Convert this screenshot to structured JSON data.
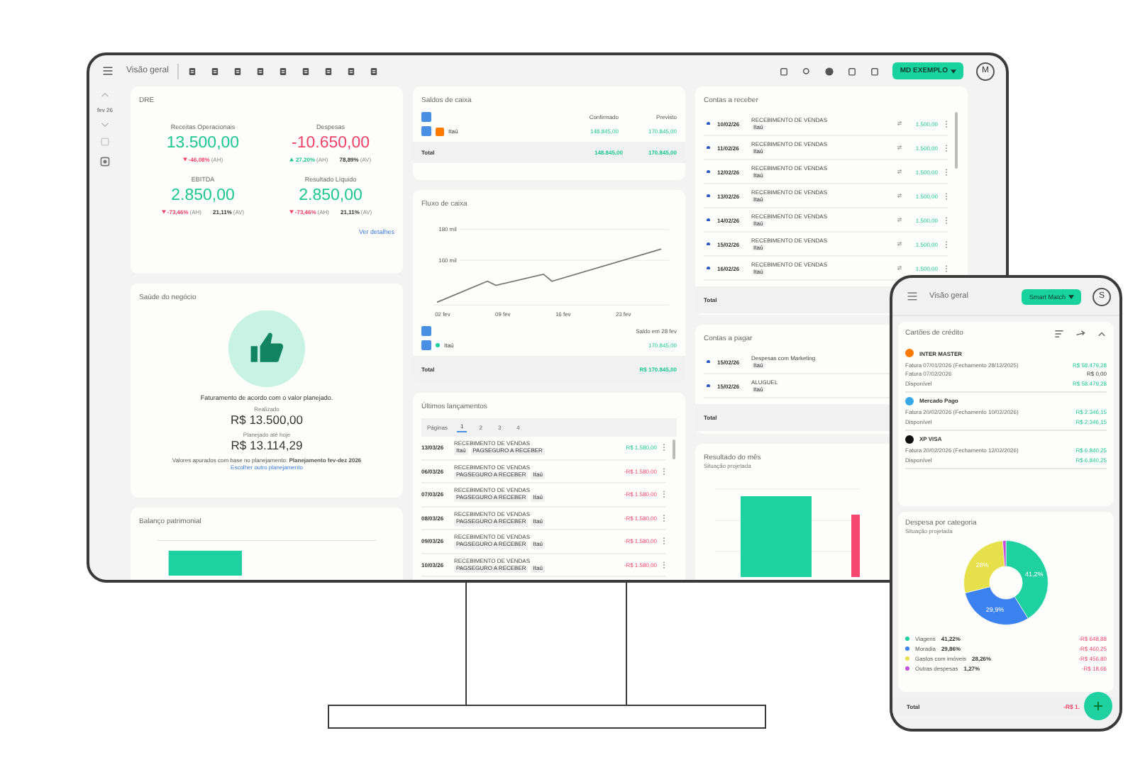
{
  "monitor": {
    "topbar": {
      "title": "Visão geral",
      "account_button": "MD EXEMPLO",
      "avatar": "M"
    },
    "rail": {
      "period": "fev 26"
    },
    "dre": {
      "title": "DRE",
      "metrics": [
        {
          "label": "Receitas Operacionais",
          "value": "13.500,00",
          "negative": false,
          "changes": [
            {
              "kind": "down",
              "text": "-46,08%",
              "tag": "(AH)"
            }
          ]
        },
        {
          "label": "Despesas",
          "value": "-10.650,00",
          "negative": true,
          "changes": [
            {
              "kind": "up",
              "text": "27,20%",
              "tag": "(AH)"
            },
            {
              "kind": "plain",
              "text": "78,89%",
              "tag": "(AV)"
            }
          ]
        },
        {
          "label": "EBITDA",
          "value": "2.850,00",
          "negative": false,
          "changes": [
            {
              "kind": "down",
              "text": "-73,46%",
              "tag": "(AH)"
            },
            {
              "kind": "plain",
              "text": "21,11%",
              "tag": "(AV)"
            }
          ]
        },
        {
          "label": "Resultado Líquido",
          "value": "2.850,00",
          "negative": false,
          "changes": [
            {
              "kind": "down",
              "text": "-73,46%",
              "tag": "(AH)"
            },
            {
              "kind": "plain",
              "text": "21,11%",
              "tag": "(AV)"
            }
          ]
        }
      ],
      "link": "Ver detalhes"
    },
    "health": {
      "title": "Saúde do negócio",
      "message": "Faturamento de acordo com o valor planejado.",
      "realized_label": "Realizado",
      "realized": "R$ 13.500,00",
      "planned_label": "Planejado até hoje",
      "planned": "R$ 13.114,29",
      "note": "Valores apurados com base no planejamento: **Planejamento fev-dez 2026**",
      "link": "Escolher outro planejamento"
    },
    "balance": {
      "title": "Balanço patrimonial"
    },
    "cash": {
      "title": "Saldos de caixa",
      "all_checked": true,
      "columns": [
        "Confirmado",
        "Previsto"
      ],
      "rows": [
        {
          "checked": true,
          "bank": "Itaú",
          "confirmed": "148.845,00",
          "projected": "170.845,00"
        }
      ],
      "total_label": "Total",
      "total_confirmed": "148.845,00",
      "total_projected": "170.845,00"
    },
    "flow": {
      "title": "Fluxo de caixa",
      "y_labels": [
        "180 mil",
        "160 mil"
      ],
      "x_labels": [
        "02 fev",
        "09 fev",
        "16 fev",
        "23 fev"
      ],
      "legend_all_checked": true,
      "legend_title": "Saldo em 28 fev",
      "legend": [
        {
          "checked": true,
          "name": "Itaú",
          "value": "170.845,00"
        }
      ],
      "total_label": "Total",
      "total": "R$ 170.845,00"
    },
    "entries": {
      "title": "Últimos lançamentos",
      "pages_label": "Páginas",
      "pages": [
        {
          "label": "1",
          "selected": true
        },
        {
          "label": "2",
          "selected": false
        },
        {
          "label": "3",
          "selected": false
        },
        {
          "label": "4",
          "selected": false
        }
      ],
      "rows": [
        {
          "date": "13/03/26",
          "description": "RECEBIMENTO DE VENDAS",
          "tags": [
            "Itaú",
            "PAGSEGURO A RECEBER"
          ],
          "amount": "R$ 1.580,00",
          "negative": false
        },
        {
          "date": "06/03/26",
          "description": "RECEBIMENTO DE VENDAS",
          "tags": [
            "PAGSEGURO A RECEBER",
            "Itaú"
          ],
          "amount": "-R$ 1.580,00",
          "negative": true
        },
        {
          "date": "07/03/26",
          "description": "RECEBIMENTO DE VENDAS",
          "tags": [
            "PAGSEGURO A RECEBER",
            "Itaú"
          ],
          "amount": "-R$ 1.580,00",
          "negative": true
        },
        {
          "date": "08/03/26",
          "description": "RECEBIMENTO DE VENDAS",
          "tags": [
            "PAGSEGURO A RECEBER",
            "Itaú"
          ],
          "amount": "-R$ 1.580,00",
          "negative": true
        },
        {
          "date": "09/03/26",
          "description": "RECEBIMENTO DE VENDAS",
          "tags": [
            "PAGSEGURO A RECEBER",
            "Itaú"
          ],
          "amount": "-R$ 1.580,00",
          "negative": true
        },
        {
          "date": "10/03/26",
          "description": "RECEBIMENTO DE VENDAS",
          "tags": [
            "PAGSEGURO A RECEBER",
            "Itaú"
          ],
          "amount": "-R$ 1.580,00",
          "negative": true
        }
      ]
    },
    "receivables": {
      "title": "Contas a receber",
      "rows": [
        {
          "date": "10/02/26",
          "description": "RECEBIMENTO DE VENDAS",
          "tag": "Itaú",
          "amount": "1.500,00"
        },
        {
          "date": "11/02/26",
          "description": "RECEBIMENTO DE VENDAS",
          "tag": "Itaú",
          "amount": "1.500,00"
        },
        {
          "date": "12/02/26",
          "description": "RECEBIMENTO DE VENDAS",
          "tag": "Itaú",
          "amount": "1.500,00"
        },
        {
          "date": "13/02/26",
          "description": "RECEBIMENTO DE VENDAS",
          "tag": "Itaú",
          "amount": "1.500,00"
        },
        {
          "date": "14/02/26",
          "description": "RECEBIMENTO DE VENDAS",
          "tag": "Itaú",
          "amount": "1.500,00"
        },
        {
          "date": "15/02/26",
          "description": "RECEBIMENTO DE VENDAS",
          "tag": "Itaú",
          "amount": "1.500,00"
        },
        {
          "date": "16/02/26",
          "description": "RECEBIMENTO DE VENDAS",
          "tag": "Itaú",
          "amount": "1.500,00"
        }
      ],
      "total_label": "Total"
    },
    "payables": {
      "title": "Contas a pagar",
      "rows": [
        {
          "date": "15/02/26",
          "description": "Despesas com Marketing",
          "tag": "Itaú"
        },
        {
          "date": "15/02/26",
          "description": "ALUGUEL",
          "tag": "Itaú"
        }
      ],
      "total_label": "Total"
    },
    "result": {
      "title": "Resultado do mês",
      "subtitle": "Situação projetada"
    }
  },
  "phone": {
    "title": "Visão geral",
    "button": "Smart Match",
    "avatar": "S",
    "cards": {
      "title": "Cartões de crédito",
      "items": [
        {
          "name": "INTER MASTER",
          "color": "#ff7a00",
          "lines": [
            {
              "label": "Fatura 07/01/2026 (Fechamento 28/12/2025)",
              "value": "R$ 58.479,28",
              "highlight": true
            },
            {
              "label": "Fatura 07/02/2026",
              "value": "R$ 0,00",
              "highlight": false
            },
            {
              "label": "Disponível",
              "value": "R$ 58.479,28",
              "highlight": true
            }
          ]
        },
        {
          "name": "Mercado Pago",
          "color": "#3aa8e6",
          "lines": [
            {
              "label": "Fatura 20/02/2026 (Fechamento 10/02/2026)",
              "value": "R$ 2.346,15",
              "highlight": true
            },
            {
              "label": "Disponível",
              "value": "R$ 2.346,15",
              "highlight": true
            }
          ]
        },
        {
          "name": "XP VISA",
          "color": "#111111",
          "lines": [
            {
              "label": "Fatura 20/02/2026 (Fechamento 12/02/2026)",
              "value": "R$ 6.840,25",
              "highlight": true
            },
            {
              "label": "Disponível",
              "value": "R$ 6.840,25",
              "highlight": true
            }
          ]
        }
      ]
    },
    "expenses": {
      "title": "Despesa por categoria",
      "subtitle": "Situação projetada",
      "chart_data": {
        "type": "donut",
        "series": [
          {
            "values": [
              41.22,
              29.86,
              27.65,
              1.27
            ]
          }
        ],
        "value_labels": [
          "41,2%",
          "29,9%",
          "28%",
          null
        ]
      },
      "legend": [
        {
          "name": "Viagens",
          "share": "41,22%",
          "amount": "-R$ 648,88",
          "color": "#1fd1a0"
        },
        {
          "name": "Moradia",
          "share": "29,86%",
          "amount": "-R$ 460,25",
          "color": "#3b82f0"
        },
        {
          "name": "Gastos com imóveis",
          "share": "28,26%",
          "amount": "-R$ 456,80",
          "color": "#e6e04a"
        },
        {
          "name": "Outras despesas",
          "share": "1,27%",
          "amount": "-R$ 18,66",
          "color": "#c44fd8"
        }
      ]
    },
    "total_label": "Total",
    "total": "-R$ 1."
  }
}
